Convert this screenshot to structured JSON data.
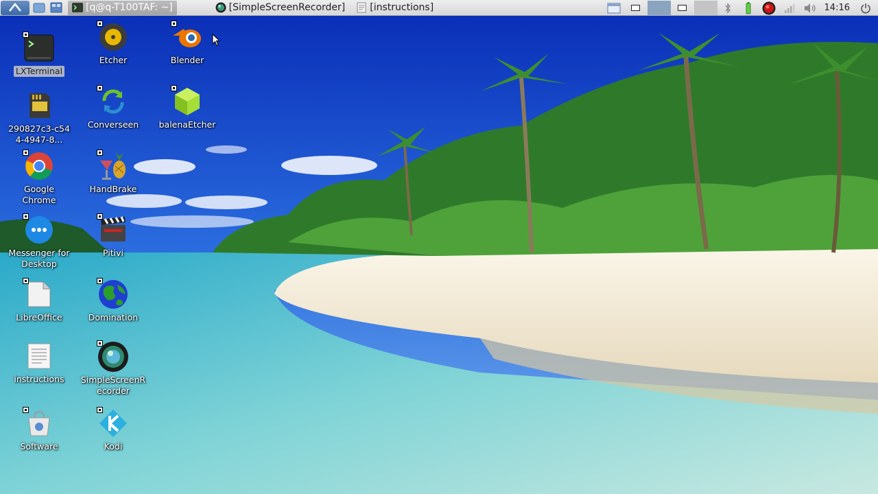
{
  "taskbar": {
    "tasks": [
      {
        "label": "[q@q-T100TAF: ~]"
      },
      {
        "label": "[SimpleScreenRecorder]"
      },
      {
        "label": "[instructions]"
      }
    ],
    "clock": "14:16"
  },
  "desktop": {
    "icons": [
      {
        "label": "LXTerminal",
        "icon": "terminal-icon",
        "selected": true
      },
      {
        "label": "290827c3-c544-4947-8...",
        "icon": "sd-card-icon"
      },
      {
        "label": "Google Chrome",
        "icon": "chrome-icon"
      },
      {
        "label": "Messenger for Desktop",
        "icon": "messenger-icon"
      },
      {
        "label": "LibreOffice",
        "icon": "libreoffice-icon"
      },
      {
        "label": "instructions",
        "icon": "text-file-icon"
      },
      {
        "label": "Software",
        "icon": "software-center-icon"
      },
      {
        "label": "Etcher",
        "icon": "etcher-icon"
      },
      {
        "label": "Converseen",
        "icon": "converseen-icon"
      },
      {
        "label": "HandBrake",
        "icon": "handbrake-icon"
      },
      {
        "label": "Pitivi",
        "icon": "pitivi-icon"
      },
      {
        "label": "Domination",
        "icon": "globe-icon"
      },
      {
        "label": "SimpleScreenRecorder",
        "icon": "screen-recorder-icon"
      },
      {
        "label": "Kodi",
        "icon": "kodi-icon"
      },
      {
        "label": "Blender",
        "icon": "blender-icon"
      },
      {
        "label": "balenaEtcher",
        "icon": "balena-etcher-icon"
      }
    ]
  },
  "colors": {
    "taskbar_bg": "#dddddd",
    "sky": "#1a4fd0",
    "sea": "#3fb8c8",
    "sand": "#f3ecdc"
  }
}
